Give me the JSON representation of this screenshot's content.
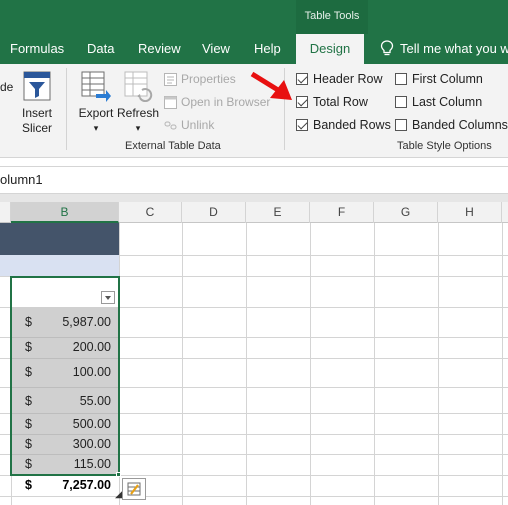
{
  "context": {
    "label": "Table Tools"
  },
  "tabs": [
    {
      "label": "Formulas"
    },
    {
      "label": "Data"
    },
    {
      "label": "Review"
    },
    {
      "label": "View"
    },
    {
      "label": "Help"
    },
    {
      "label": "Design"
    }
  ],
  "tell_me": {
    "label": "Tell me what you w"
  },
  "ribbon": {
    "partial_left": "de",
    "insert_slicer": {
      "line1": "Insert",
      "line2": "Slicer"
    },
    "export": {
      "label": "Export",
      "arrow": "▾"
    },
    "refresh": {
      "label": "Refresh",
      "arrow": "▾"
    },
    "properties": "Properties",
    "open_in_browser": "Open in Browser",
    "unlink": "Unlink",
    "group_external": "External Table Data",
    "style_options": {
      "header_row": {
        "label": "Header Row",
        "checked": true
      },
      "total_row": {
        "label": "Total Row",
        "checked": true
      },
      "banded_rows": {
        "label": "Banded Rows",
        "checked": true
      },
      "first_column": {
        "label": "First Column",
        "checked": false
      },
      "last_column": {
        "label": "Last Column",
        "checked": false
      },
      "banded_columns": {
        "label": "Banded Columns",
        "checked": false
      }
    },
    "group_style_options": "Table Style Options"
  },
  "formula_bar": {
    "text": "olumn1"
  },
  "columns": [
    "B",
    "C",
    "D",
    "E",
    "F",
    "G",
    "H"
  ],
  "cells": [
    {
      "currency": "$",
      "value": "5,987.00"
    },
    {
      "currency": "$",
      "value": "200.00"
    },
    {
      "currency": "$",
      "value": "100.00"
    },
    {
      "currency": "$",
      "value": "55.00"
    },
    {
      "currency": "$",
      "value": "500.00"
    },
    {
      "currency": "$",
      "value": "300.00"
    },
    {
      "currency": "$",
      "value": "115.00"
    }
  ],
  "total": {
    "currency": "$",
    "value": "7,257.00"
  },
  "colors": {
    "excel_green": "#217346",
    "arrow_red": "#e81010",
    "table_dark": "#44546a",
    "table_light": "#d9e1f2"
  },
  "icons": [
    "insert-slicer-icon",
    "export-icon",
    "refresh-icon",
    "properties-icon",
    "open-in-browser-icon",
    "unlink-icon",
    "lightbulb-icon",
    "quick-analysis-icon",
    "filter-dropdown-icon",
    "red-arrow-icon"
  ]
}
